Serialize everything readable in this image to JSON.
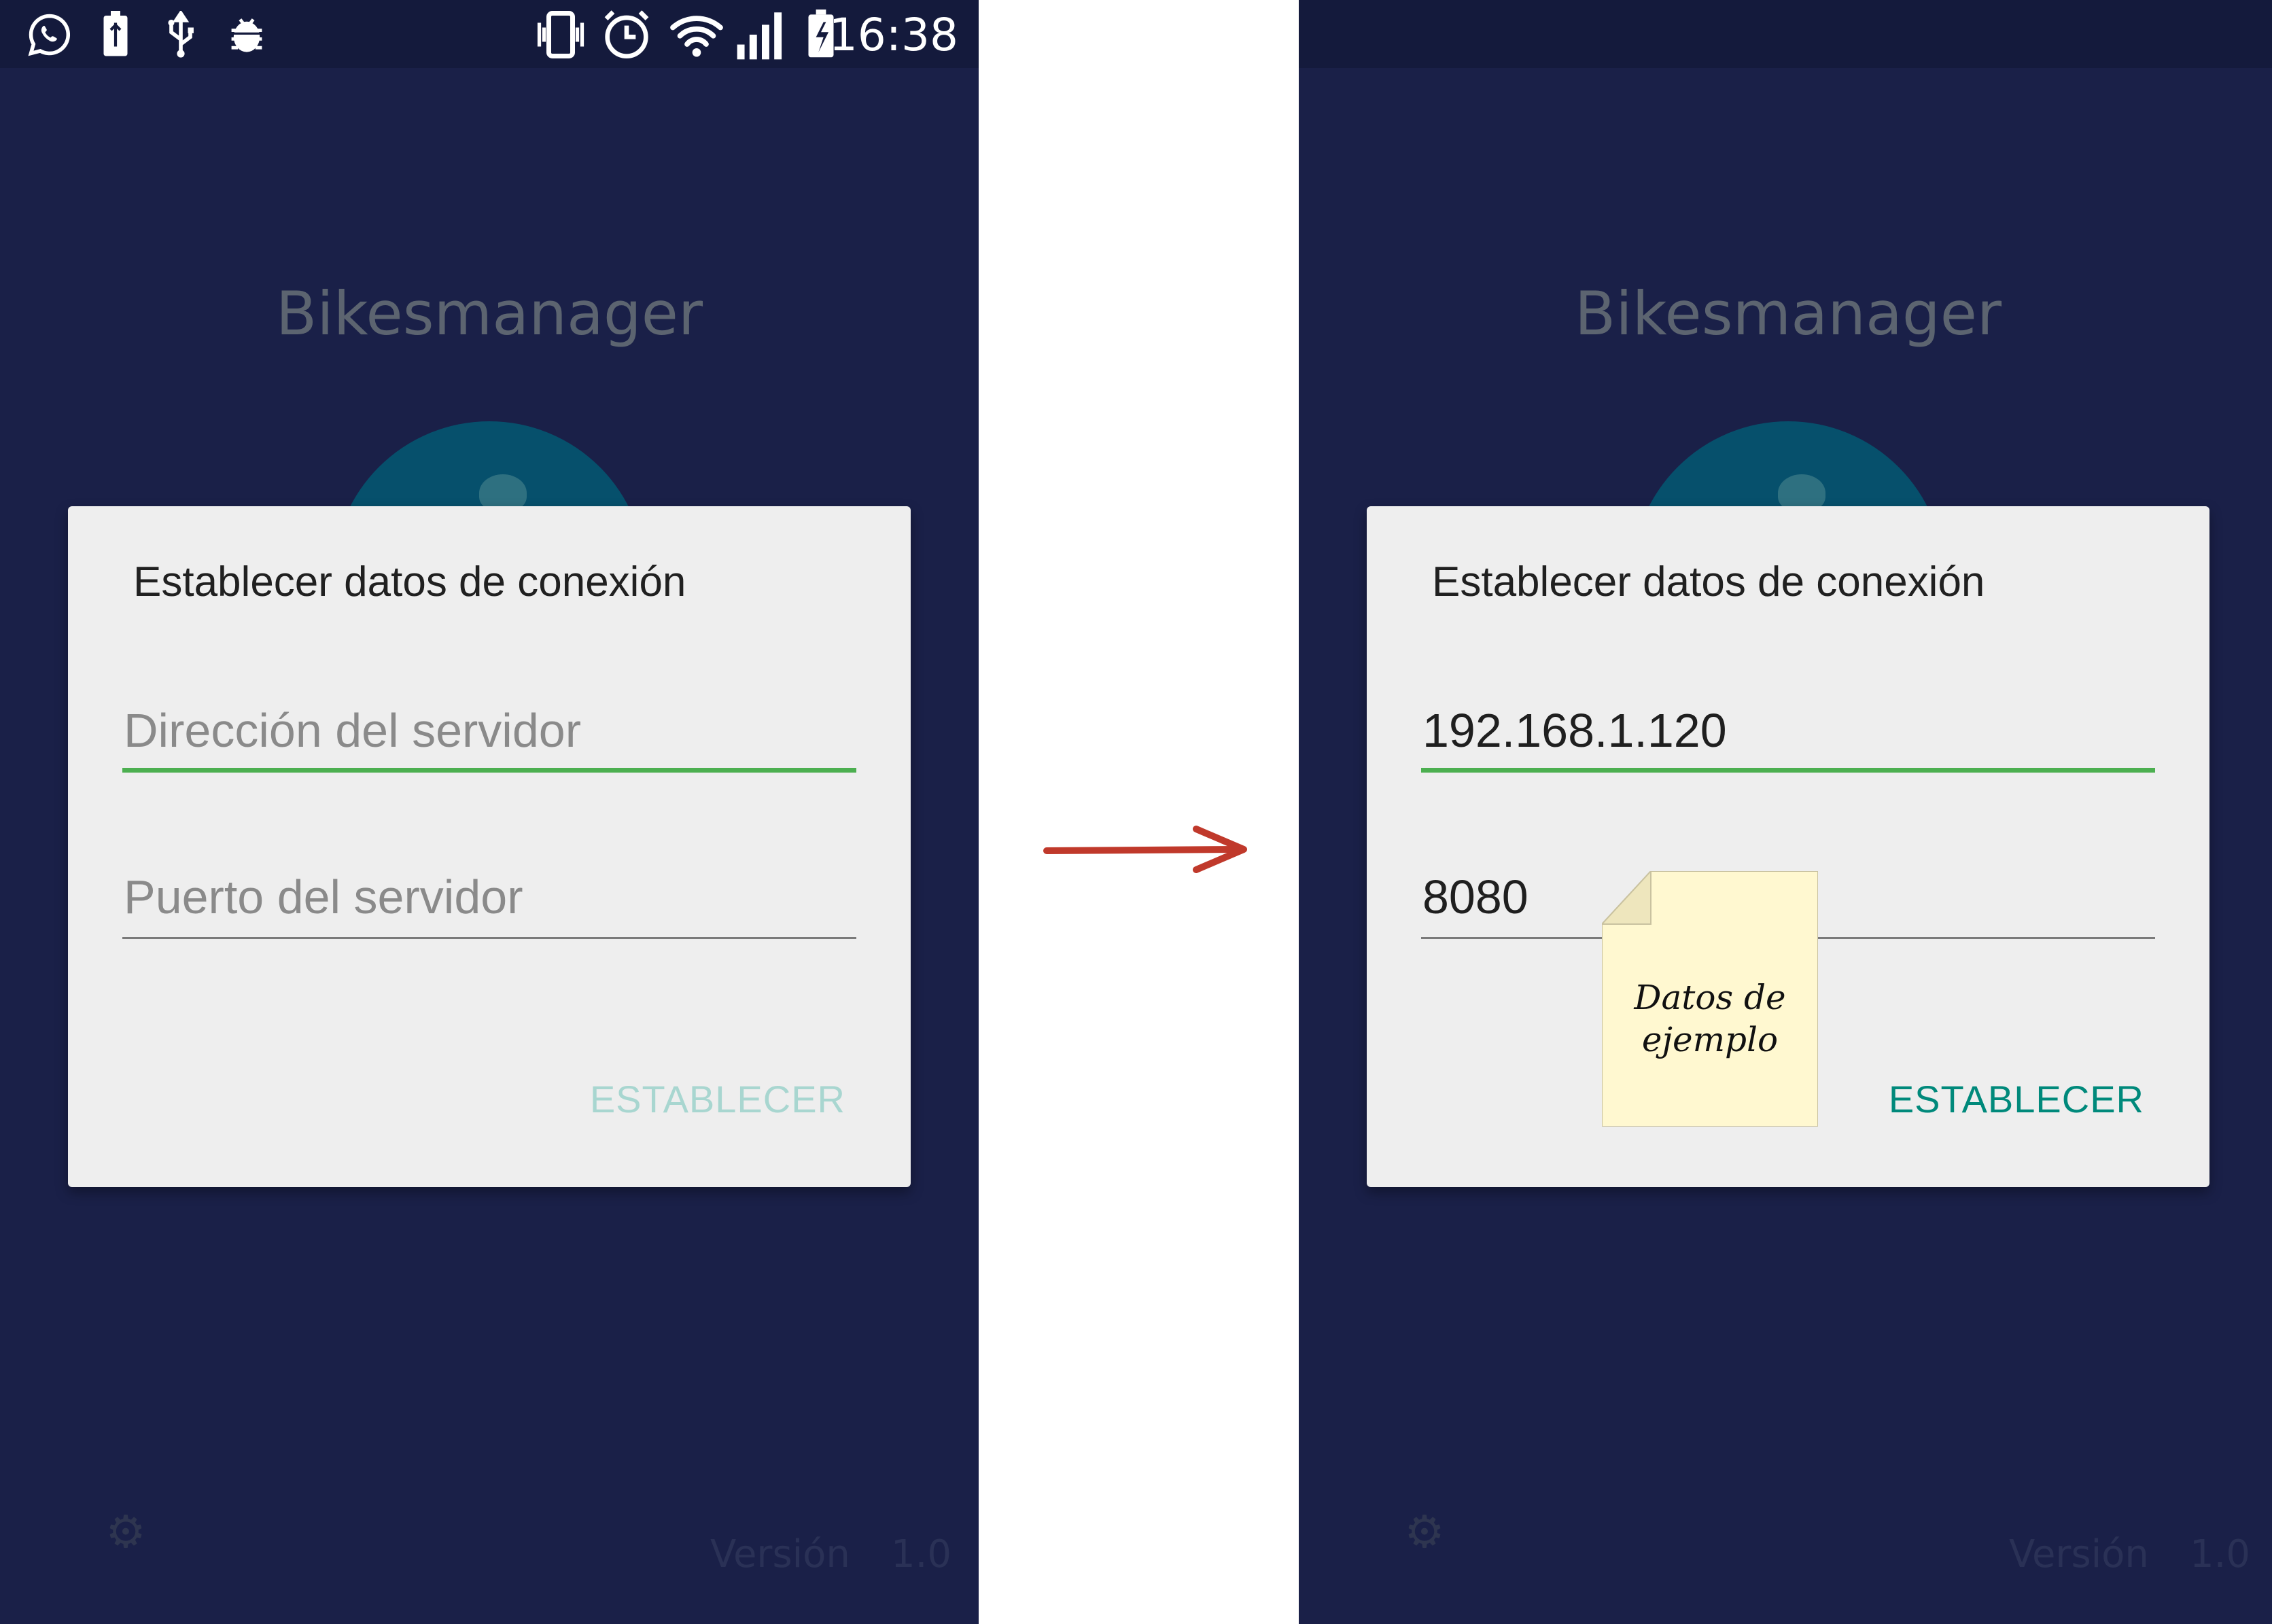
{
  "status_bar": {
    "time": "16:38",
    "left_icons": [
      "whatsapp-icon",
      "battery-usb-icon",
      "usb-icon",
      "android-debug-icon"
    ],
    "right_icons": [
      "vibrate-icon",
      "alarm-icon",
      "wifi-icon",
      "signal-icon",
      "battery-charging-icon"
    ]
  },
  "app": {
    "title": "Bikesmanager",
    "version_label": "Versión",
    "version_number": "1.0"
  },
  "dialog_before": {
    "title": "Establecer datos de conexión",
    "server_address_placeholder": "Dirección del servidor",
    "server_port_placeholder": "Puerto del servidor",
    "set_button_label": "ESTABLECER",
    "set_button_enabled": false
  },
  "dialog_after": {
    "title": "Establecer datos de conexión",
    "server_address_value": "192.168.1.120",
    "server_port_value": "8080",
    "set_button_label": "ESTABLECER",
    "set_button_enabled": true
  },
  "annotation": {
    "note_line1": "Datos de",
    "note_line2": "ejemplo"
  },
  "colors": {
    "app_background": "#1a2048",
    "dialog_background": "#eeeeee",
    "focus_underline": "#4caf50",
    "button_enabled": "#00897b",
    "button_disabled": "#a8d6d0",
    "arrow": "#c0392b",
    "sticky_note": "#fff8d0"
  }
}
